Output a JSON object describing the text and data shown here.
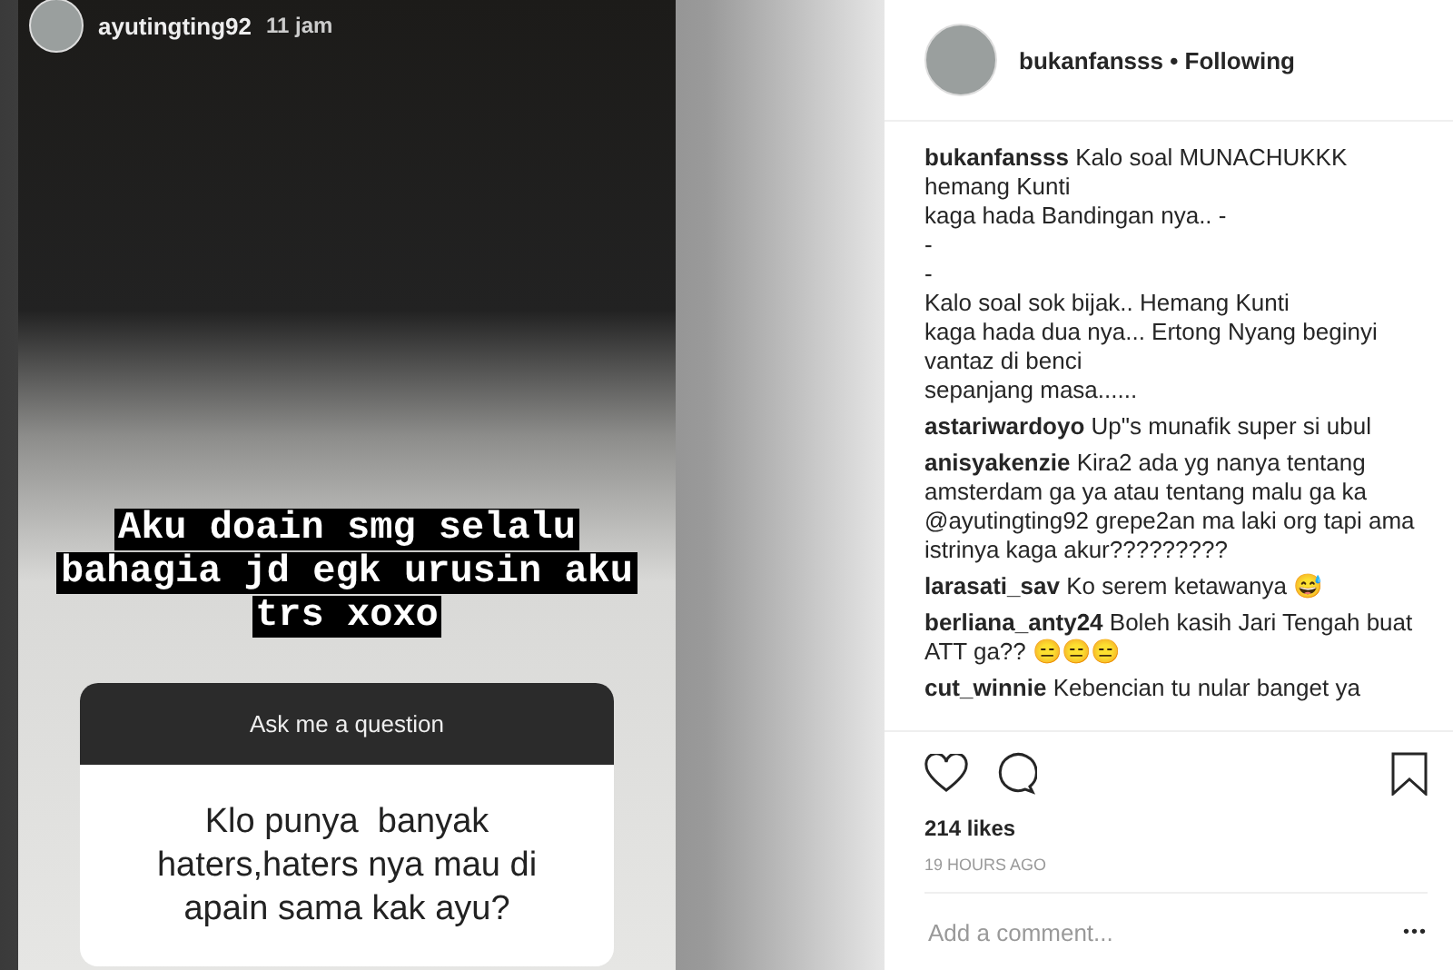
{
  "story": {
    "username": "ayutingting92",
    "time": "11 jam",
    "caption_lines": [
      "Aku doain smg selalu",
      "bahagia jd egk urusin aku",
      "trs xoxo"
    ],
    "question": {
      "title": "Ask me a question",
      "lines": [
        "Klo punya  banyak",
        "haters,haters nya mau di",
        "apain sama kak ayu?"
      ]
    }
  },
  "post": {
    "username": "bukanfansss",
    "separator": "•",
    "follow_status": "Following",
    "caption": {
      "user": "bukanfansss",
      "lines": [
        "Kalo soal MUNACHUKKK",
        "hemang Kunti",
        "kaga hada Bandingan nya.. -",
        "-",
        "-",
        "Kalo soal sok bijak.. Hemang Kunti",
        "kaga hada dua nya... Ertong Nyang beginyi",
        "vantaz di benci",
        "sepanjang masa......"
      ]
    },
    "comments": [
      {
        "user": "astariwardoyo",
        "text": "Up\"s munafik super si ubul"
      },
      {
        "user": "anisyakenzie",
        "text": "Kira2 ada yg nanya tentang amsterdam ga ya atau tentang malu ga ka @ayutingting92 grepe2an ma laki org tapi ama istrinya kaga akur?????????"
      },
      {
        "user": "larasati_sav",
        "text": "Ko serem ketawanya 😅"
      },
      {
        "user": "berliana_anty24",
        "text": "Boleh kasih Jari Tengah buat ATT ga?? 😑😑😑"
      },
      {
        "user": "cut_winnie",
        "text": "Kebencian tu nular banget ya"
      }
    ],
    "liked": false,
    "saved": false,
    "likes": "214 likes",
    "time": "19 HOURS AGO",
    "comment_placeholder": "Add a comment...",
    "more": "•••"
  }
}
